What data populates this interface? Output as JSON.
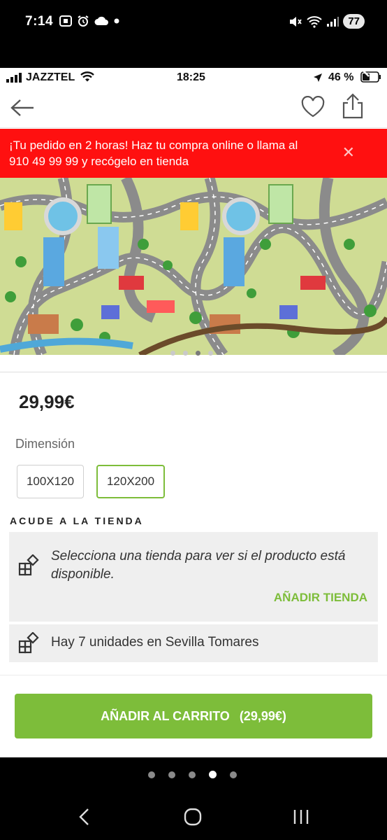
{
  "android_status": {
    "time": "7:14",
    "battery": "77",
    "left_icons": [
      "screenshot-icon",
      "alarm-icon",
      "cloud-icon",
      "dot-icon"
    ],
    "right_icons": [
      "mute-icon",
      "wifi-icon",
      "signal-icon"
    ]
  },
  "ios_status": {
    "carrier": "JAZZTEL",
    "time": "18:25",
    "battery": "46 %"
  },
  "topbar": {
    "icons": [
      "back-arrow-icon",
      "heart-icon",
      "share-icon"
    ]
  },
  "promo": {
    "text": "¡Tu pedido en 2 horas! Haz tu compra online o llama al 910 49 99 99 y recógelo en tienda",
    "close": "✕"
  },
  "carousel": {
    "slide_count": 4,
    "active_index": 2
  },
  "product": {
    "price": "29,99€",
    "dimension_label": "Dimensión",
    "sizes": [
      {
        "label": "100X120",
        "selected": false
      },
      {
        "label": "120X200",
        "selected": true
      }
    ]
  },
  "store": {
    "section_title": "ACUDE A LA TIENDA",
    "select_message": "Selecciona una tienda para ver si el producto está disponible.",
    "add_store": "AÑADIR TIENDA",
    "units_message": "Hay 7 unidades en Sevilla Tomares"
  },
  "cart": {
    "label": "AÑADIR AL CARRITO",
    "price": "(29,99€)"
  },
  "page_indicator": {
    "count": 5,
    "active_index": 3
  },
  "nav": {
    "icons": [
      "back-nav-icon",
      "home-nav-icon",
      "recents-nav-icon"
    ]
  },
  "colors": {
    "accent_green": "#7dbd3a",
    "promo_red": "#ff1010"
  }
}
